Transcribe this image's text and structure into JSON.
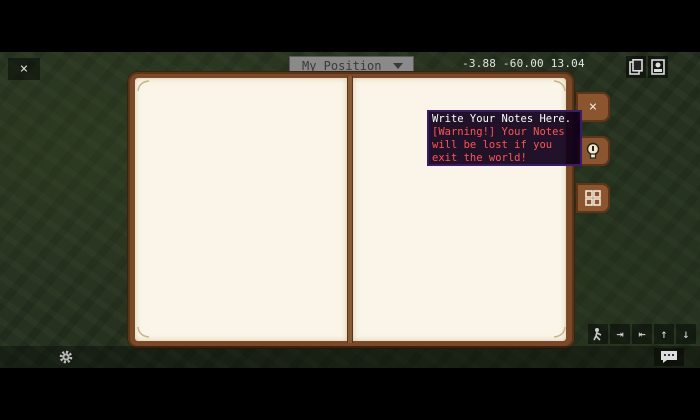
{
  "hud": {
    "close_label": "×",
    "position_select": {
      "value": "My Position"
    },
    "coordinates": "-3.88 -60.00 13.04"
  },
  "notes_book": {
    "close_label": "×",
    "tooltip": {
      "line1": "Write Your Notes Here.",
      "line2": "[Warning!] Your Notes will be lost if you exit the world!"
    }
  },
  "icons": {
    "top_right": [
      "copy-icon",
      "profile-icon"
    ],
    "side": [
      "close-icon",
      "lightbulb-icon",
      "grid-icon"
    ],
    "bottom_right": [
      "sneak-icon",
      "tab-right-icon",
      "tab-left-icon",
      "arrow-up-icon",
      "arrow-down-icon"
    ],
    "bottom": [
      "gear-icon",
      "chat-icon"
    ]
  },
  "controls": {
    "tab_right": "⇥",
    "tab_left": "⇤",
    "up": "↑",
    "down": "↓"
  },
  "colors": {
    "book_frame": "#7a4a28",
    "page": "#faf5e8",
    "tooltip_bg": "#10001a",
    "tooltip_border": "#3a1a6a",
    "warning_text": "#ff5555"
  }
}
